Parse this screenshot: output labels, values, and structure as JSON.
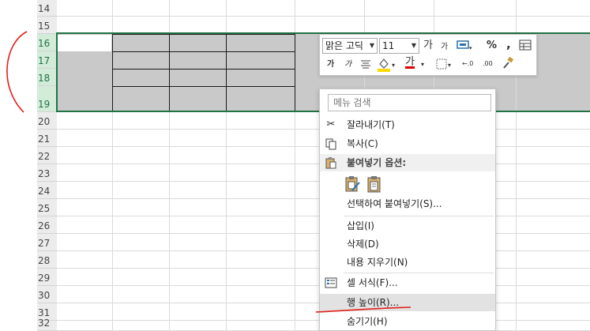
{
  "rows": [
    {
      "num": "14",
      "selected": false
    },
    {
      "num": "15",
      "selected": false
    },
    {
      "num": "16",
      "selected": true
    },
    {
      "num": "17",
      "selected": true
    },
    {
      "num": "18",
      "selected": true
    },
    {
      "num": "19",
      "selected": true
    },
    {
      "num": "20",
      "selected": false
    },
    {
      "num": "21",
      "selected": false
    },
    {
      "num": "22",
      "selected": false
    },
    {
      "num": "23",
      "selected": false
    },
    {
      "num": "24",
      "selected": false
    },
    {
      "num": "25",
      "selected": false
    },
    {
      "num": "26",
      "selected": false
    },
    {
      "num": "27",
      "selected": false
    },
    {
      "num": "28",
      "selected": false
    },
    {
      "num": "29",
      "selected": false
    },
    {
      "num": "30",
      "selected": false
    },
    {
      "num": "31",
      "selected": false
    },
    {
      "num": "32",
      "selected": false
    }
  ],
  "mini_toolbar": {
    "font_name": "맑은 고딕",
    "font_size": "11",
    "grow_font": "가",
    "shrink_font": "가",
    "percent": "%",
    "comma": ",",
    "bold": "가",
    "italic": "가",
    "font_color_glyph": "가",
    "dec_decimal": "←.0",
    "inc_decimal": ".00",
    "colors": {
      "highlight": "#ffd800",
      "font": "#e00000"
    }
  },
  "context_menu": {
    "search_placeholder": "메뉴 검색",
    "cut": "잘라내기(T)",
    "copy": "복사(C)",
    "paste_options": "붙여넣기 옵션:",
    "paste_special": "선택하여 붙여넣기(S)...",
    "insert": "삽입(I)",
    "delete": "삭제(D)",
    "clear": "내용 지우기(N)",
    "format_cells": "셀 서식(F)...",
    "row_height": "행 높이(R)...",
    "hide": "숨기기(H)"
  },
  "annotation_color": "#e0201c"
}
